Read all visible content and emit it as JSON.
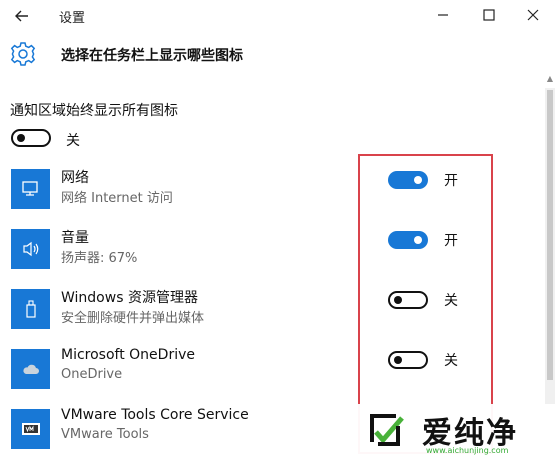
{
  "window": {
    "title": "设置",
    "back_icon": "arrow-left-icon",
    "minimize_icon": "minimize-icon",
    "maximize_icon": "maximize-icon",
    "close_icon": "close-icon"
  },
  "header": {
    "icon": "gear-icon",
    "title": "选择在任务栏上显示哪些图标"
  },
  "always_show": {
    "label": "通知区域始终显示所有图标",
    "state": "off",
    "state_label": "关"
  },
  "items": [
    {
      "icon": "network-icon",
      "name": "网络",
      "sub": "网络 Internet 访问",
      "state": "on",
      "state_label": "开"
    },
    {
      "icon": "volume-icon",
      "name": "音量",
      "sub": "扬声器: 67%",
      "state": "on",
      "state_label": "开"
    },
    {
      "icon": "usb-drive-icon",
      "name": "Windows 资源管理器",
      "sub": "安全删除硬件并弹出媒体",
      "state": "off",
      "state_label": "关"
    },
    {
      "icon": "cloud-icon",
      "name": "Microsoft OneDrive",
      "sub": "OneDrive",
      "state": "off",
      "state_label": "关"
    },
    {
      "icon": "vmware-icon",
      "name": "VMware Tools Core Service",
      "sub": "VMware Tools"
    }
  ],
  "colors": {
    "accent": "#1878d6",
    "highlight_border": "#d9434b"
  },
  "watermark": {
    "text": "爱纯净",
    "url": "www.aichunjing.com"
  }
}
